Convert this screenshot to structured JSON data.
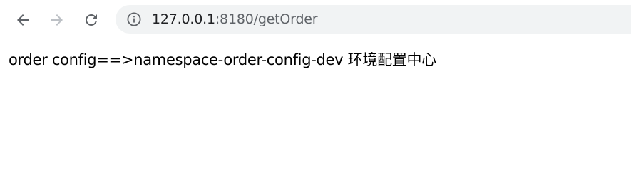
{
  "browser": {
    "url": {
      "host": "127.0.0.1",
      "rest": ":8180/getOrder"
    },
    "icons": {
      "back": "back-arrow-icon",
      "forward": "forward-arrow-icon",
      "reload": "reload-icon",
      "site_info": "info-icon"
    }
  },
  "page": {
    "body_text": "order config==>namespace-order-config-dev 环境配置中心"
  },
  "colors": {
    "toolbar_background": "#ffffff",
    "omnibox_background": "#f1f3f4",
    "icon_active": "#5f6368",
    "icon_disabled": "#bdc1c6",
    "url_host": "#202124",
    "url_path": "#5f6368",
    "page_text": "#000000"
  }
}
